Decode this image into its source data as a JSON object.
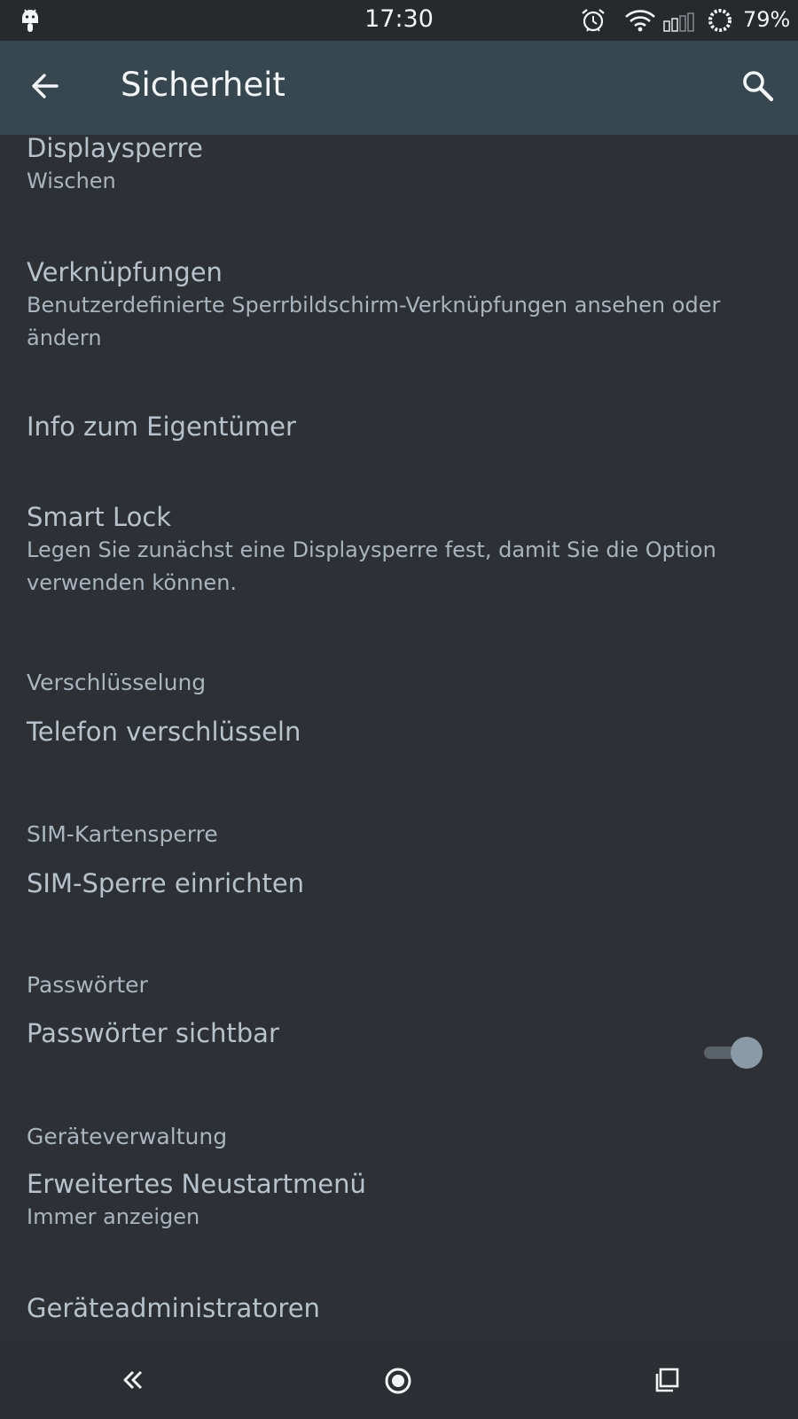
{
  "status_bar": {
    "time": "17:30",
    "battery": "79%",
    "icons": [
      "android-debug-icon",
      "alarm-icon",
      "wifi-icon",
      "signal-icon",
      "battery-icon"
    ]
  },
  "toolbar": {
    "title": "Sicherheit",
    "back_icon": "arrow-left-icon",
    "search_icon": "search-icon"
  },
  "items": [
    {
      "title": "Displaysperre",
      "subtitle": "Wischen"
    },
    {
      "title": "Verknüpfungen",
      "subtitle_line1": "Benutzerdefinierte Sperrbildschirm-Verknüpfungen ansehen oder",
      "subtitle_line2": "ändern"
    },
    {
      "title": "Info zum Eigentümer"
    },
    {
      "title": "Smart Lock",
      "subtitle_line1": "Legen Sie zunächst eine Displaysperre fest, damit Sie die Option",
      "subtitle_line2": "verwenden können."
    }
  ],
  "sections": {
    "encryption": {
      "header": "Verschlüsselung",
      "item": "Telefon verschlüsseln"
    },
    "sim": {
      "header": "SIM-Kartensperre",
      "item": "SIM-Sperre einrichten"
    },
    "passwords": {
      "header": "Passwörter",
      "item": "Passwörter sichtbar",
      "toggle_on": true
    },
    "device": {
      "header": "Geräteverwaltung",
      "item1_title": "Erweitertes Neustartmenü",
      "item1_subtitle": "Immer anzeigen",
      "item2_title": "Geräteadministratoren"
    }
  },
  "colors": {
    "background": "#2d3135",
    "toolbar": "#37474f",
    "statusbar": "#262a2d",
    "text": "#b7c3cc"
  },
  "nav_bar": {
    "icons": [
      "back-icon",
      "home-icon",
      "recents-icon"
    ]
  }
}
